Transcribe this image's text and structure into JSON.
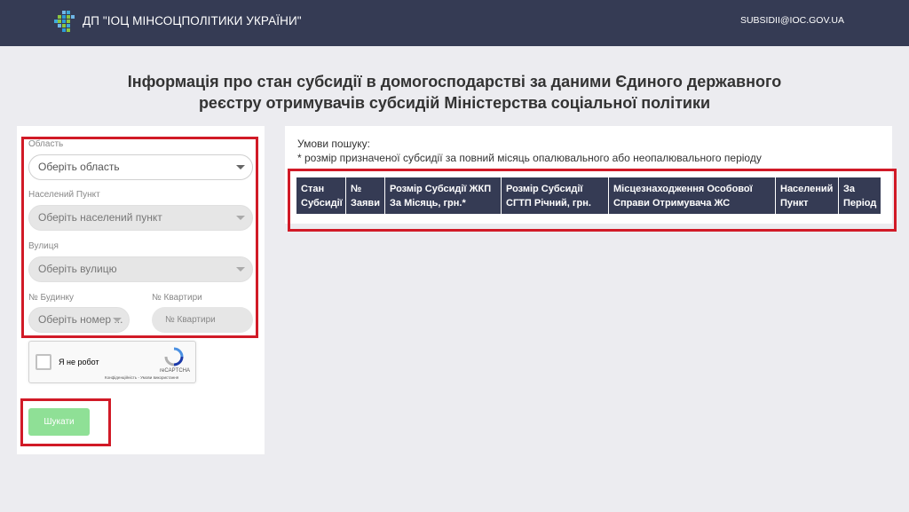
{
  "header": {
    "brand": "ДП \"ІОЦ МІНСОЦПОЛІТИКИ УКРАЇНИ\"",
    "email": "SUBSIDII@IOC.GOV.UA",
    "logo_icon": "pixel-grid-logo"
  },
  "page": {
    "title_line1": "Інформація про стан субсидії в домогосподарстві за даними Єдиного державного",
    "title_line2": "реєстру отримувачів субсидій Міністерства соціальної політики"
  },
  "form": {
    "region_label": "Область",
    "region_placeholder": "Оберіть область",
    "locality_label": "Населений Пункт",
    "locality_placeholder": "Оберіть населений пункт",
    "street_label": "Вулиця",
    "street_placeholder": "Оберіть вулицю",
    "house_label": "№ Будинку",
    "house_placeholder": "Оберіть номер ...",
    "apartment_label": "№ Квартири",
    "apartment_placeholder": "№ Квартири"
  },
  "captcha": {
    "label": "Я не робот",
    "brand": "reCAPTCHA",
    "privacy": "Конфіденційність - Умови використання"
  },
  "search_button": "Шукати",
  "results": {
    "conditions_title": "Умови пошуку:",
    "conditions_note": "* розмір призначеної субсидії за повний місяць опалювального або неопалювального періоду",
    "columns": [
      "Стан Субсидії",
      "№ Заяви",
      "Розмір Субсидії ЖКП За Місяць, грн.*",
      "Розмір Субсидії СГТП Річний, грн.",
      "Місцезнаходження Особової Справи Отримувача ЖС",
      "Населений Пункт",
      "За Період"
    ]
  },
  "colors": {
    "header_bg": "#353b54",
    "highlight": "#d11a27",
    "button": "#8fe096"
  }
}
